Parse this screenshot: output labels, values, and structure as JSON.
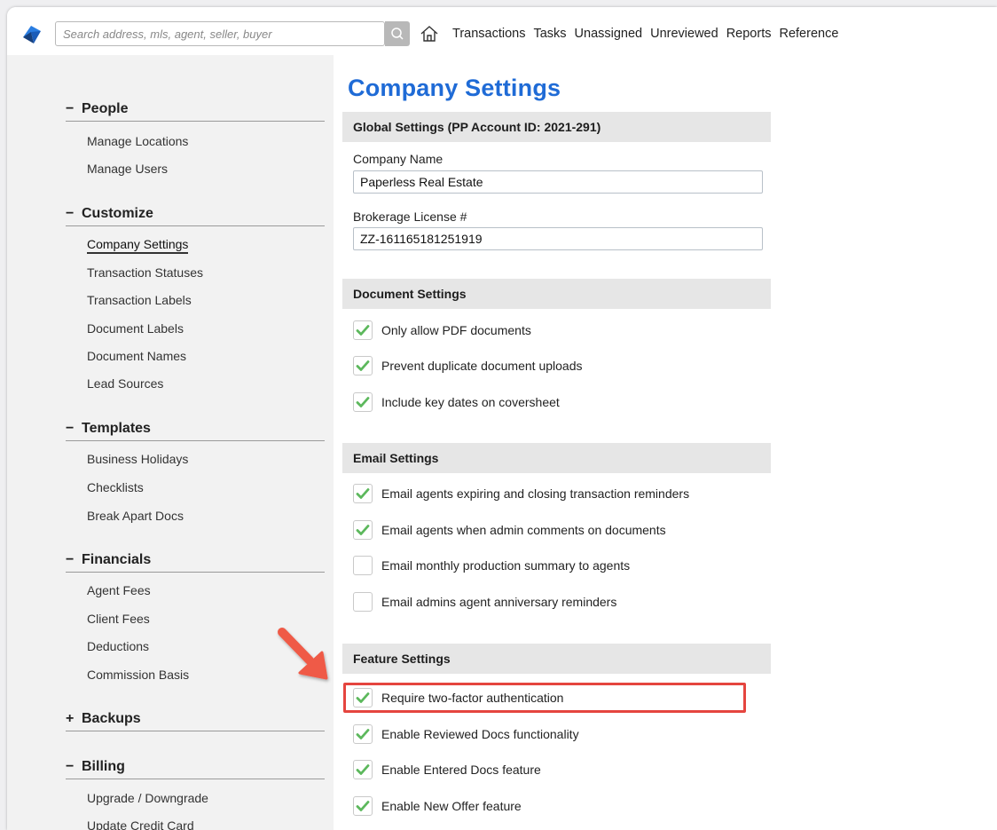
{
  "topbar": {
    "search_placeholder": "Search address, mls, agent, seller, buyer",
    "nav": [
      "Transactions",
      "Tasks",
      "Unassigned",
      "Unreviewed",
      "Reports",
      "Reference"
    ]
  },
  "sidebar": {
    "sections": [
      {
        "symbol": "−",
        "title": "People",
        "items": [
          "Manage Locations",
          "Manage Users"
        ]
      },
      {
        "symbol": "−",
        "title": "Customize",
        "items": [
          "Company Settings",
          "Transaction Statuses",
          "Transaction Labels",
          "Document Labels",
          "Document Names",
          "Lead Sources"
        ]
      },
      {
        "symbol": "−",
        "title": "Templates",
        "items": [
          "Business Holidays",
          "Checklists",
          "Break Apart Docs"
        ]
      },
      {
        "symbol": "−",
        "title": "Financials",
        "items": [
          "Agent Fees",
          "Client Fees",
          "Deductions",
          "Commission Basis"
        ]
      },
      {
        "symbol": "+",
        "title": "Backups",
        "items": []
      },
      {
        "symbol": "−",
        "title": "Billing",
        "items": [
          "Upgrade / Downgrade",
          "Update Credit Card"
        ]
      }
    ],
    "active_item": "Company Settings"
  },
  "main": {
    "title": "Company Settings",
    "global": {
      "heading": "Global Settings (PP Account ID: 2021-291)",
      "company_name_label": "Company Name",
      "company_name_value": "Paperless Real Estate",
      "license_label": "Brokerage License #",
      "license_value": "ZZ-161165181251919"
    },
    "document": {
      "heading": "Document Settings",
      "options": [
        {
          "label": "Only allow PDF documents",
          "checked": true
        },
        {
          "label": "Prevent duplicate document uploads",
          "checked": true
        },
        {
          "label": "Include key dates on coversheet",
          "checked": true
        }
      ]
    },
    "email": {
      "heading": "Email Settings",
      "options": [
        {
          "label": "Email agents expiring and closing transaction reminders",
          "checked": true
        },
        {
          "label": "Email agents when admin comments on documents",
          "checked": true
        },
        {
          "label": "Email monthly production summary to agents",
          "checked": false
        },
        {
          "label": "Email admins agent anniversary reminders",
          "checked": false
        }
      ]
    },
    "feature": {
      "heading": "Feature Settings",
      "options": [
        {
          "label": "Require two-factor authentication",
          "checked": true
        },
        {
          "label": "Enable Reviewed Docs functionality",
          "checked": true
        },
        {
          "label": "Enable Entered Docs feature",
          "checked": true
        },
        {
          "label": "Enable New Offer feature",
          "checked": true
        }
      ]
    }
  },
  "colors": {
    "title_blue": "#1f6bd6",
    "check_green": "#5cb85c",
    "highlight_red": "#e5453f",
    "logo_blue": "#1f6bd6"
  },
  "icons": {
    "logo": "logo-icon",
    "search": "search-icon",
    "home": "home-icon",
    "check": "check-icon",
    "callout": "arrow-icon"
  }
}
